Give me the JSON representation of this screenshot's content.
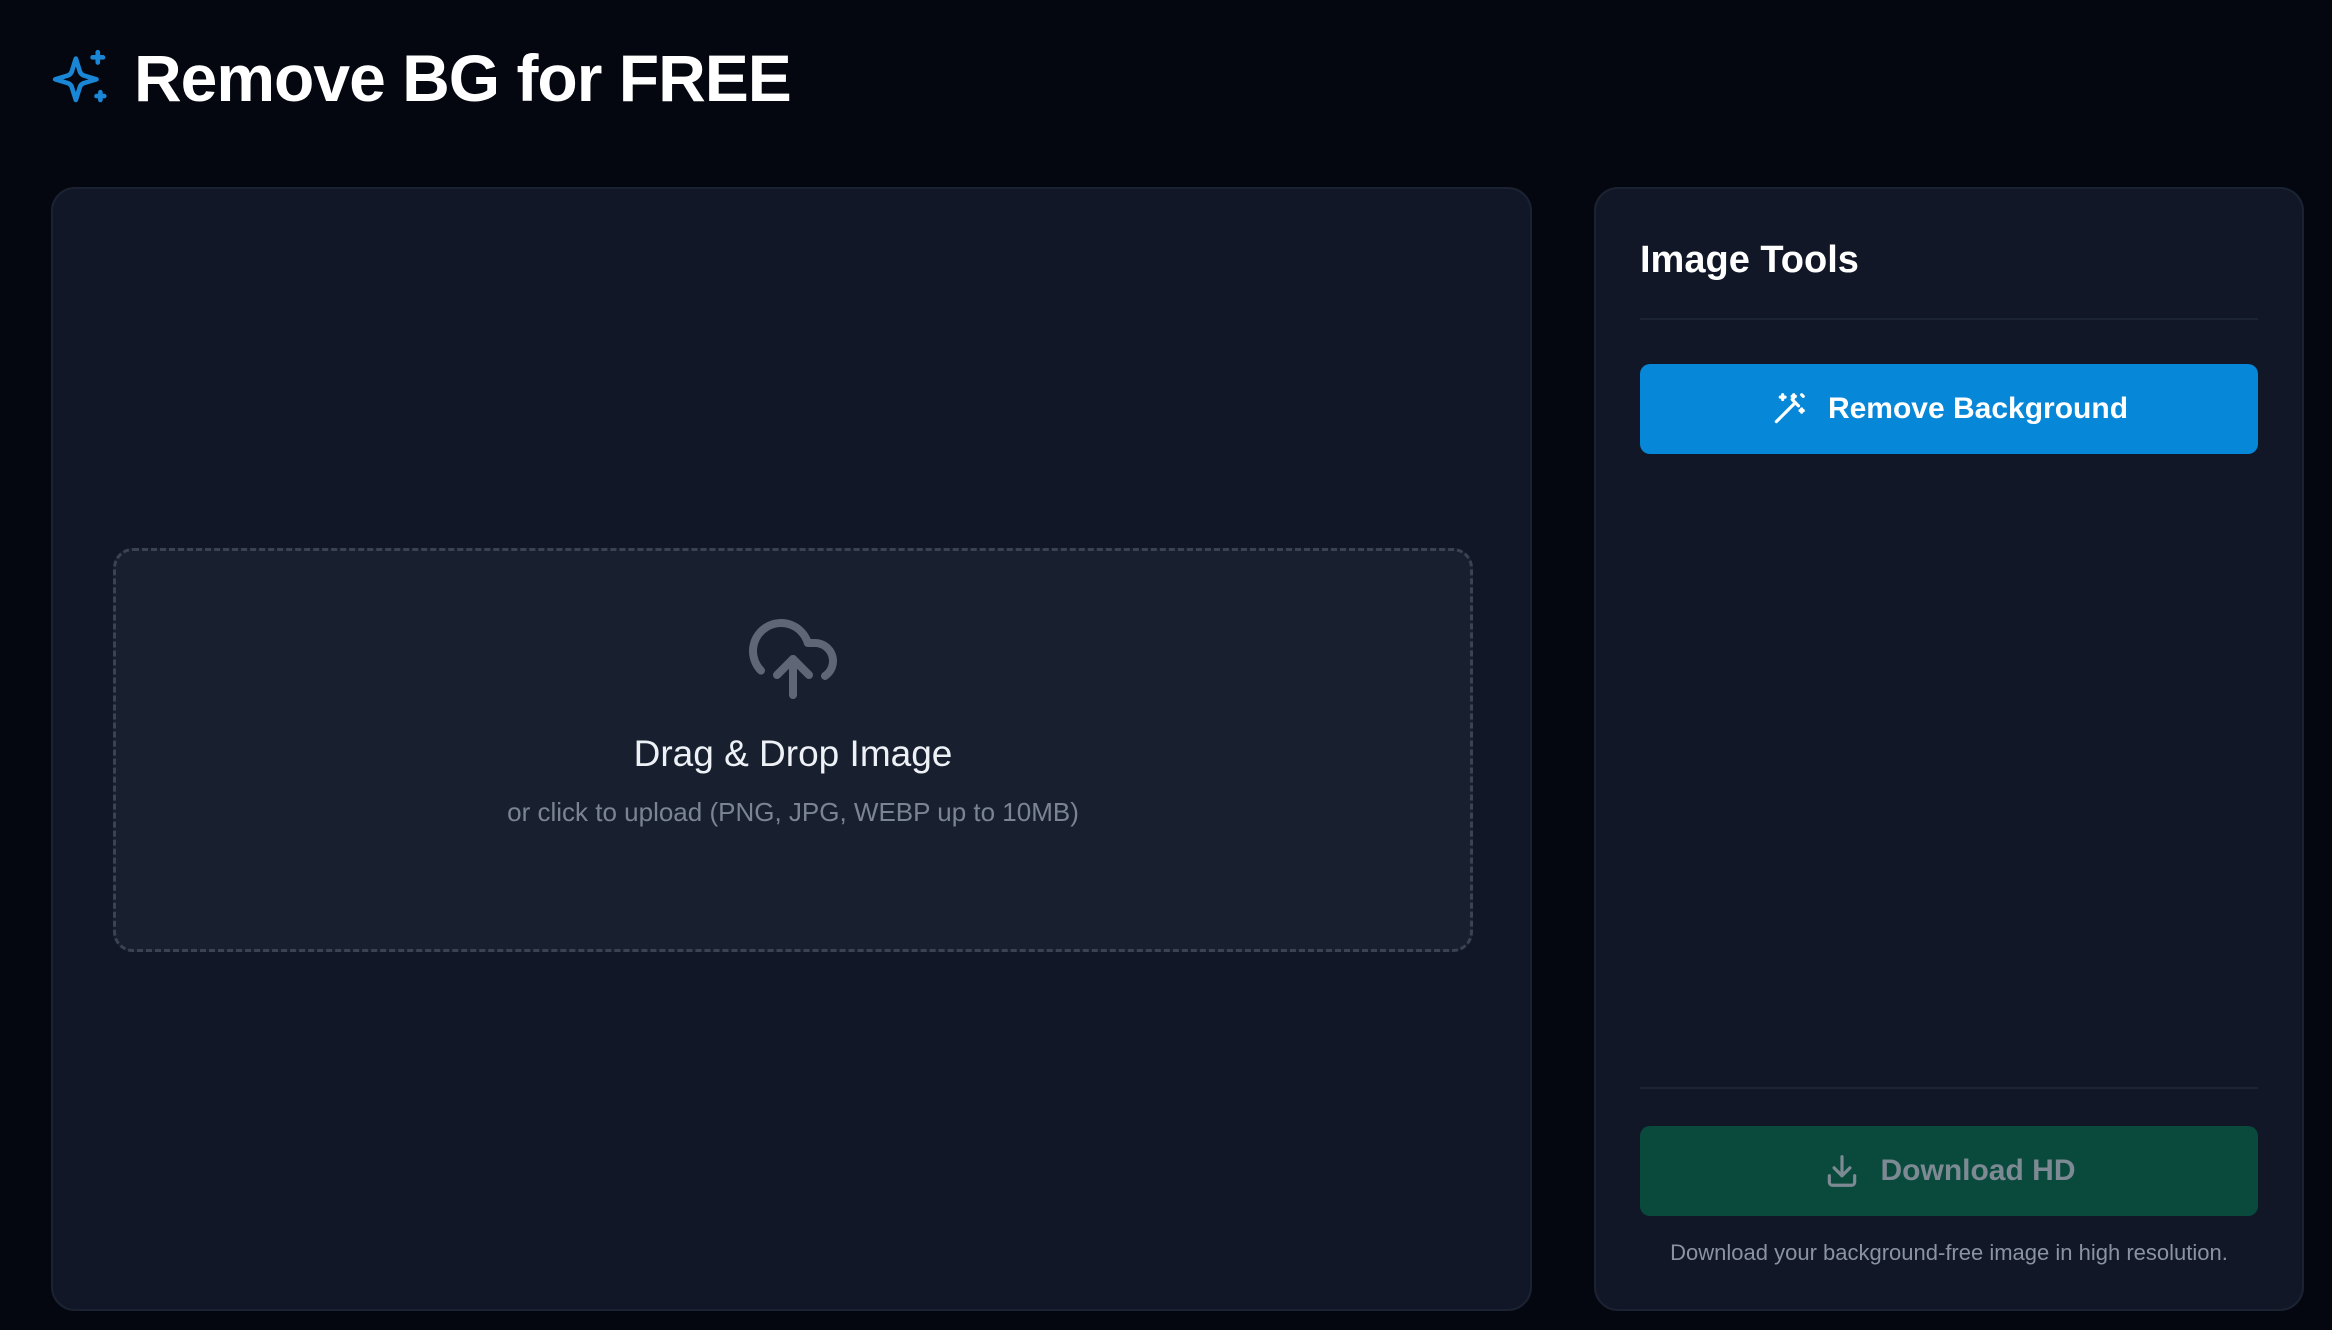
{
  "header": {
    "icon": "sparkles-icon",
    "title": "Remove BG for FREE"
  },
  "upload": {
    "icon": "cloud-upload-icon",
    "title": "Drag & Drop Image",
    "subtitle": "or click to upload (PNG, JPG, WEBP up to 10MB)"
  },
  "tools": {
    "title": "Image Tools",
    "remove_button": {
      "icon": "magic-wand-icon",
      "label": "Remove Background"
    },
    "download_button": {
      "icon": "download-icon",
      "label": "Download HD"
    },
    "note": "Download your background-free image in high resolution."
  },
  "colors": {
    "background": "#04070f",
    "panel": "#111726",
    "accent_blue": "#0787d7",
    "download_green_disabled": "#0a4a3d",
    "logo_blue": "#1a86d6"
  }
}
